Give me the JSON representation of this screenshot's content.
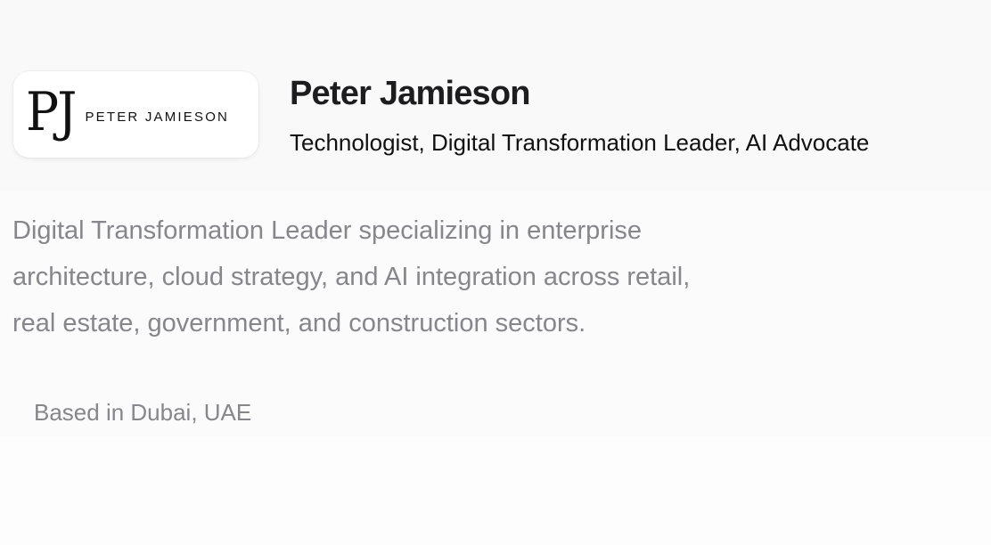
{
  "profile": {
    "logo": {
      "monogram": "PJ",
      "wordmark": "PETER JAMIESON"
    },
    "name": "Peter Jamieson",
    "title": "Technologist, Digital Transformation Leader, AI Advocate",
    "bio_lines": [
      "Digital Transformation Leader specializing in enterprise",
      "architecture, cloud strategy, and AI integration across retail,",
      "real estate, government, and construction sectors."
    ],
    "location": "Based in Dubai, UAE"
  },
  "colors": {
    "heading": "#1d1d1f",
    "muted_text": "#86868b",
    "card_background": "#ffffff",
    "page_background": "#fafafa"
  }
}
